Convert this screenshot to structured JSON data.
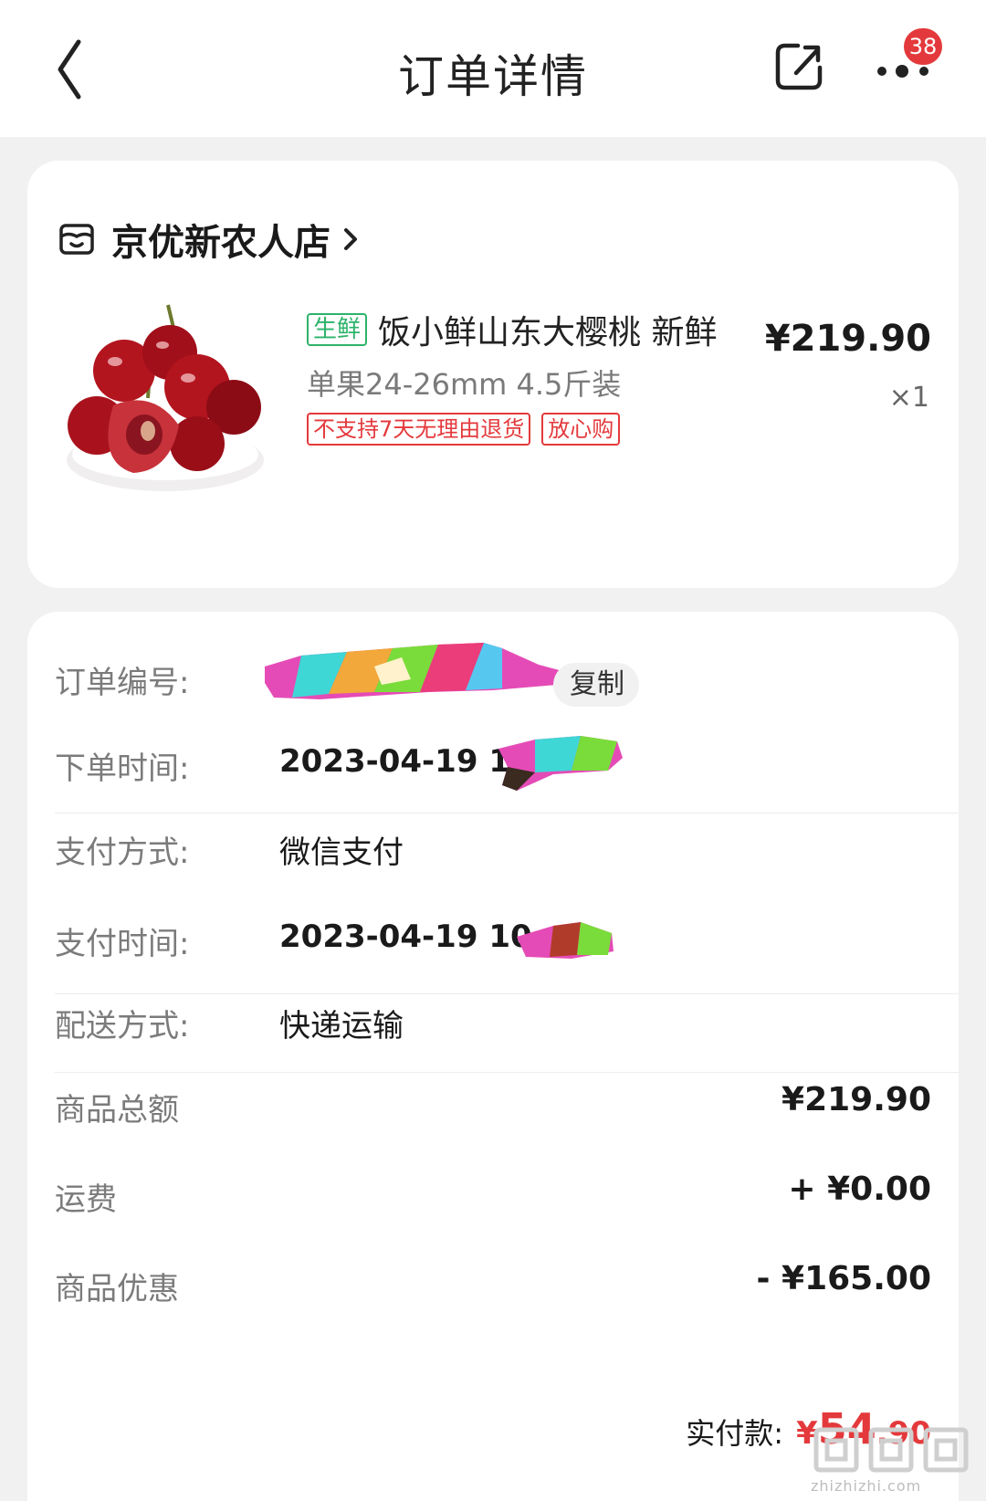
{
  "header": {
    "title": "订单详情",
    "badge_count": "38",
    "icons": {
      "back": "back-chevron-icon",
      "share": "share-icon",
      "more": "more-dots-icon"
    }
  },
  "store": {
    "name": "京优新农人店",
    "icon": "store-icon"
  },
  "product": {
    "tag": "生鲜",
    "title": "饭小鲜山东大樱桃 新鲜",
    "spec": "单果24-26mm 4.5斤装",
    "tags": [
      "不支持7天无理由退货",
      "放心购"
    ],
    "price": "¥219.90",
    "qty": "×1"
  },
  "order": {
    "number_label": "订单编号:",
    "copy_label": "复制",
    "order_time_label": "下单时间:",
    "order_time_value": "2023-04-19 10",
    "pay_method_label": "支付方式:",
    "pay_method_value": "微信支付",
    "pay_time_label": "支付时间:",
    "pay_time_value": "2023-04-19 10",
    "delivery_label": "配送方式:",
    "delivery_value": "快递运输"
  },
  "amounts": {
    "subtotal_label": "商品总额",
    "subtotal_value": "¥219.90",
    "shipping_label": "运费",
    "shipping_value": "+ ¥0.00",
    "discount_label": "商品优惠",
    "discount_value": "- ¥165.00",
    "paid_label": "实付款:",
    "paid_currency": "¥",
    "paid_int": "54",
    "paid_dec": ".90"
  },
  "watermark": {
    "text": "zhizhizhi.com"
  },
  "colors": {
    "accent_red": "#e4393c",
    "fresh_green": "#2db36b",
    "label_gray": "#7b7b7b"
  }
}
